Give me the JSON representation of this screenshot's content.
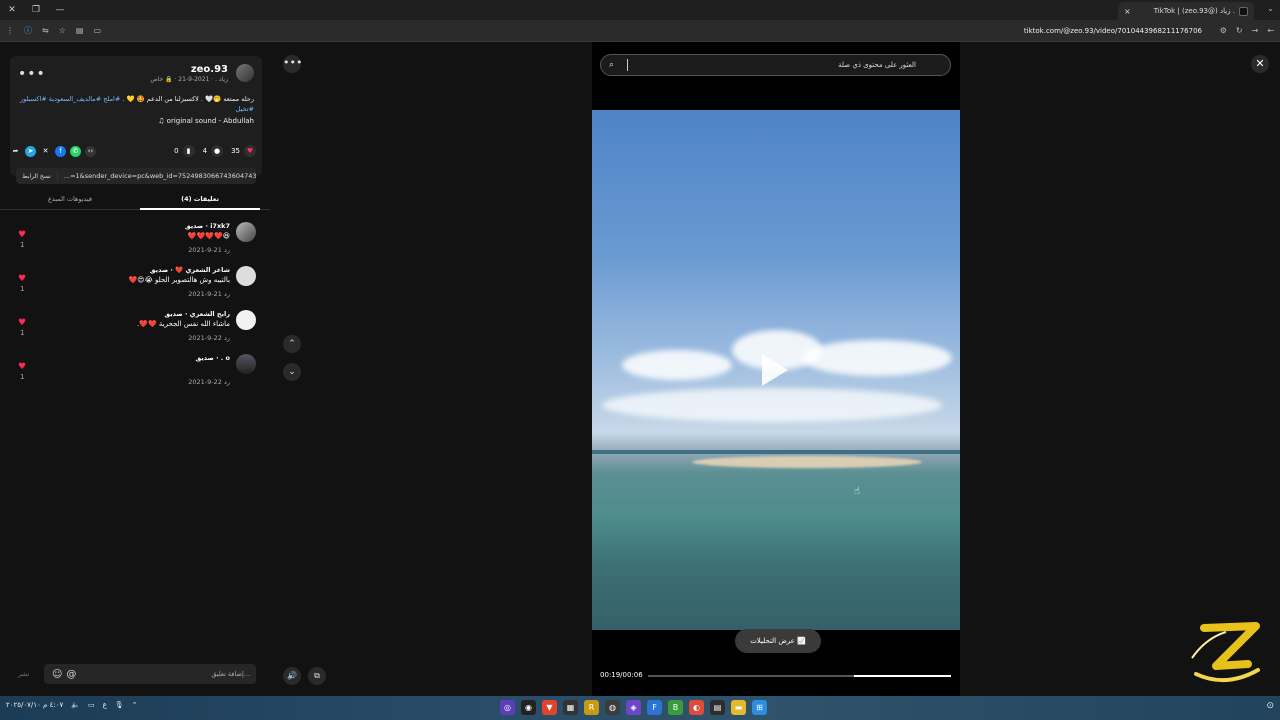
{
  "browser": {
    "tab_title": "TikTok | (zeo.93@) زياد .",
    "url": "tiktok.com/@zeo.93/video/7010443968211176706",
    "new_tab": "+",
    "close_tab": "×"
  },
  "post": {
    "username": "zeo.93",
    "meta": "زياد . · 2021-9-21 · 🔒 خاص",
    "caption_text": "رحله ممتعه 🤭🤍 . لاكسبزلنا من الدعم 🤩 💛 . ",
    "caption_tags": "#املج #مالديف_السعودية #اكسبلور #تخيل",
    "sound": "♫ original sound - Abdullah",
    "likes": "35",
    "comments": "4",
    "saves": "0",
    "copy_link_label": "نسخ الرابط",
    "link_value": "...=1&sender_device=pc&web_id=7524983066743604743",
    "tab_comments": "(4) تعليقات",
    "tab_creator_videos": "فيديوهات المبدع"
  },
  "comments": [
    {
      "name": "i7xk7 · صديق",
      "text": "😆❤️❤️❤️❤️",
      "date": "2021-9-21  رد",
      "likes": "1"
    },
    {
      "name": "شاعر الشعري ❤️ · صديق",
      "text": "بالتيبه وش هالتصوير الحلو 😭😍❤️",
      "date": "2021-9-21  رد",
      "likes": "1"
    },
    {
      "name": "رابح الشعري · صديق",
      "text": "ماشاء الله نفس الجحرية ❤️❤️.",
      "date": "2021-9-22  رد",
      "likes": "1"
    },
    {
      "name": "o . · صديق",
      "text": "",
      "date": "2021-9-22  رد",
      "likes": "1"
    }
  ],
  "composer": {
    "placeholder": "إضافة تعليق...",
    "post_label": "نشر"
  },
  "video": {
    "search_query": "العثور على محتوى ذي صلة",
    "analytics_label": "عرض التحليلات 📈",
    "time": "00:19/00:06",
    "progress": 0.32
  },
  "taskbar": {
    "time_date": "٤:٠٧ م ٢٠٢٥/٠٧/١٠",
    "lang": "ع"
  }
}
